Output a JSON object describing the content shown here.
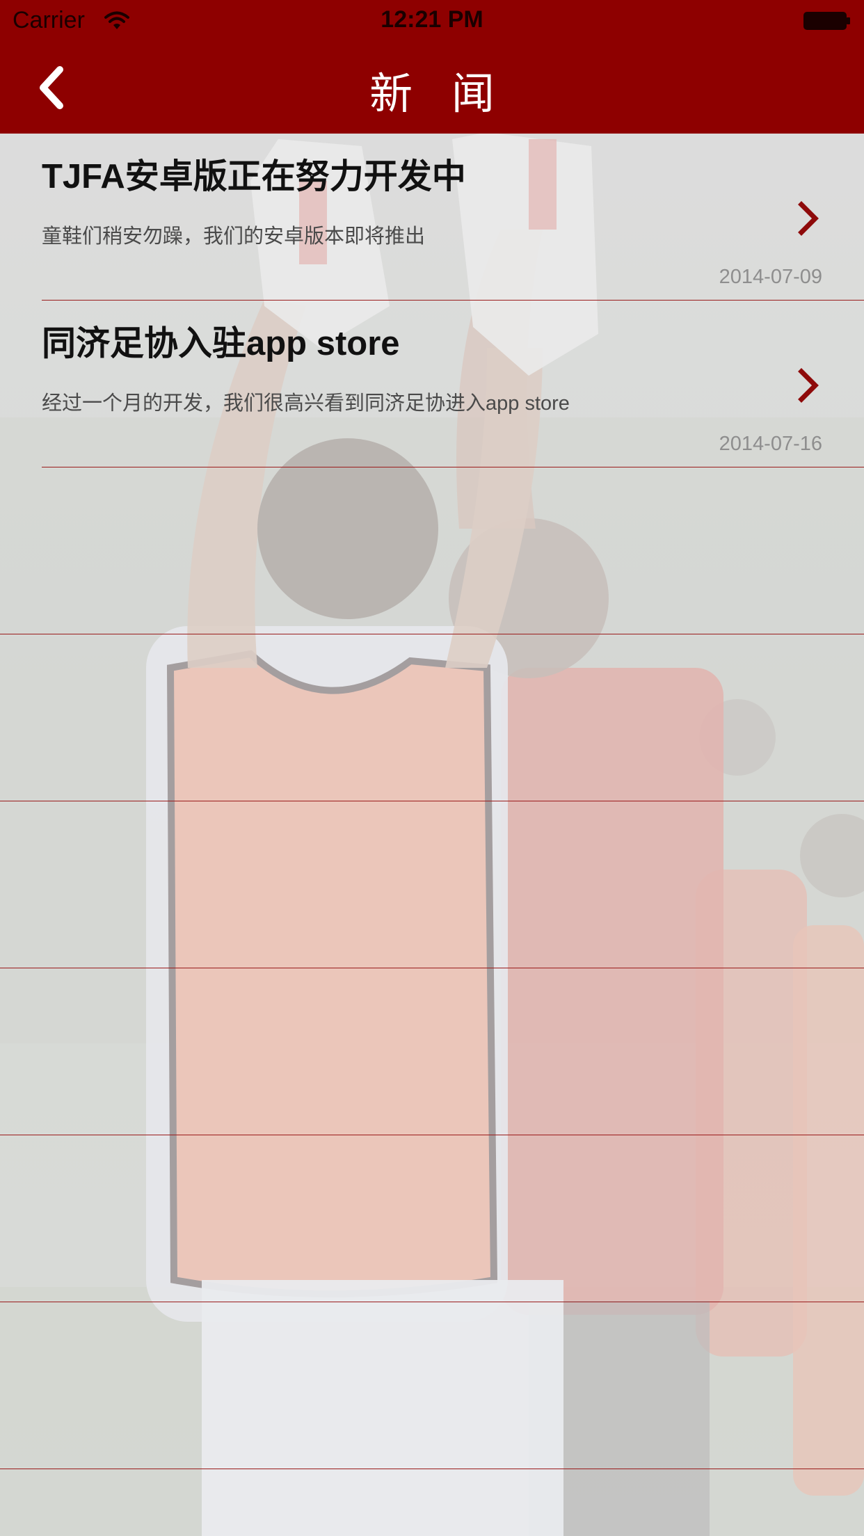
{
  "status_bar": {
    "carrier": "Carrier",
    "time": "12:21 PM"
  },
  "nav": {
    "title": "新 闻",
    "back_icon": "chevron-left-icon"
  },
  "news": [
    {
      "title": "TJFA安卓版正在努力开发中",
      "summary": "童鞋们稍安勿躁，我们的安卓版本即将推出",
      "date": "2014-07-09"
    },
    {
      "title": "同济足协入驻app store",
      "summary": "经过一个月的开发，我们很高兴看到同济足协进入app store",
      "date": "2014-07-16"
    }
  ],
  "colors": {
    "brand": "#8e0000",
    "separator": "#9a1b1b",
    "chevron": "#8e0a0a"
  }
}
